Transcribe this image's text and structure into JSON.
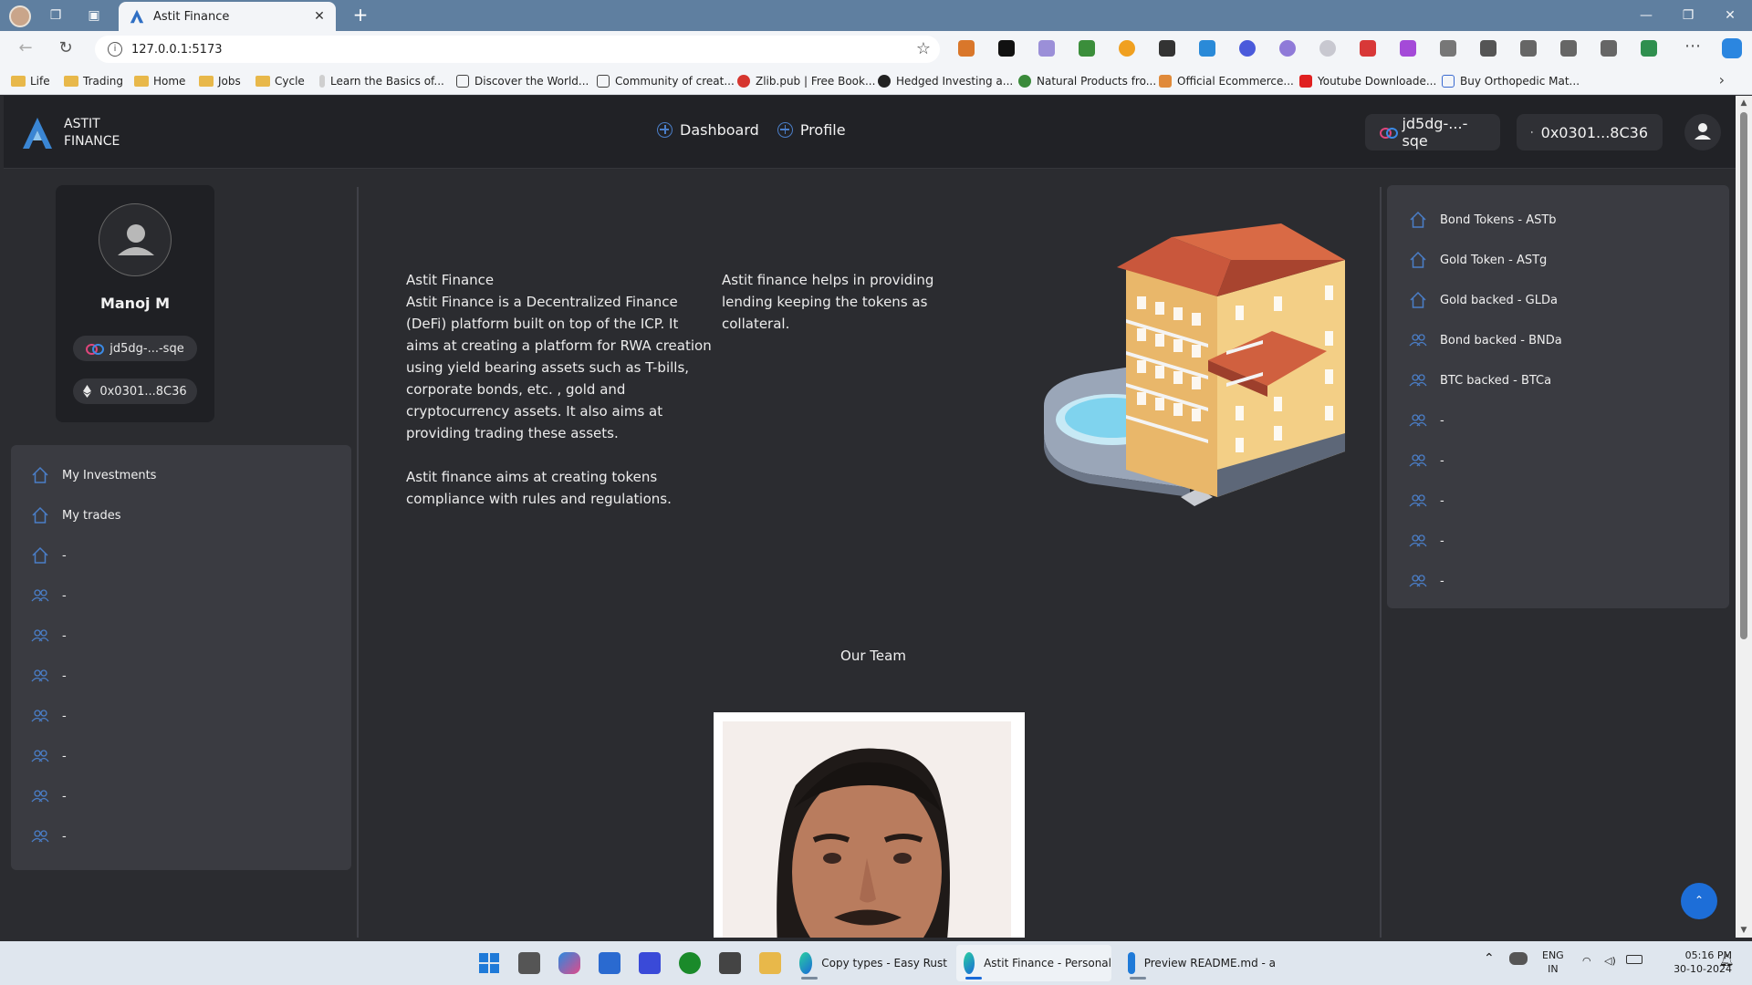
{
  "browser": {
    "tab_title": "Astit Finance",
    "address": "127.0.0.1:5173",
    "bookmarks": [
      {
        "label": "Life",
        "kind": "folder"
      },
      {
        "label": "Trading",
        "kind": "folder"
      },
      {
        "label": "Home",
        "kind": "folder"
      },
      {
        "label": "Jobs",
        "kind": "folder"
      },
      {
        "label": "Cycle",
        "kind": "folder"
      },
      {
        "label": "Learn the Basics of...",
        "kind": "link"
      },
      {
        "label": "Discover the World...",
        "kind": "link"
      },
      {
        "label": "Community of creat...",
        "kind": "link"
      },
      {
        "label": "Zlib.pub | Free Book...",
        "kind": "link"
      },
      {
        "label": "Hedged Investing a...",
        "kind": "link"
      },
      {
        "label": "Natural Products fro...",
        "kind": "link"
      },
      {
        "label": "Official Ecommerce...",
        "kind": "link"
      },
      {
        "label": "Youtube Downloade...",
        "kind": "link"
      },
      {
        "label": "Buy Orthopedic Mat...",
        "kind": "link"
      }
    ]
  },
  "header": {
    "brand_line1": "ASTIT",
    "brand_line2": "FINANCE",
    "nav": [
      {
        "label": "Dashboard"
      },
      {
        "label": "Profile"
      }
    ],
    "principal_chip": "jd5dg-...-sqe",
    "wallet_chip": "0x0301...8C36"
  },
  "profile": {
    "name": "Manoj M",
    "principal": "jd5dg-...-sqe",
    "wallet": "0x0301...8C36"
  },
  "sidebar": {
    "items": [
      {
        "label": "My Investments",
        "icon": "home-icon"
      },
      {
        "label": "My trades",
        "icon": "home-icon"
      },
      {
        "label": "-",
        "icon": "home-icon"
      },
      {
        "label": "-",
        "icon": "users-icon"
      },
      {
        "label": "-",
        "icon": "users-icon"
      },
      {
        "label": "-",
        "icon": "users-icon"
      },
      {
        "label": "-",
        "icon": "users-icon"
      },
      {
        "label": "-",
        "icon": "users-icon"
      },
      {
        "label": "-",
        "icon": "users-icon"
      },
      {
        "label": "-",
        "icon": "users-icon"
      }
    ]
  },
  "main": {
    "intro_title": "Astit Finance",
    "intro_body": "Astit Finance is a Decentralized Finance (DeFi) platform built on top of the ICP. It aims at creating a platform for RWA creation using yield bearing assets such as T-bills, corporate bonds, etc. , gold and cryptocurrency assets. It also aims at providing trading these assets.",
    "intro_tokens": "Astit finance aims at creating tokens compliance with rules and regulations.",
    "lending": "Astit finance helps in providing lending keeping the tokens as collateral.",
    "team_title": "Our Team"
  },
  "right_panel": {
    "items": [
      {
        "label": "Bond Tokens - ASTb",
        "icon": "home-icon"
      },
      {
        "label": "Gold Token - ASTg",
        "icon": "home-icon"
      },
      {
        "label": "Gold backed - GLDa",
        "icon": "home-icon"
      },
      {
        "label": "Bond backed - BNDa",
        "icon": "users-icon"
      },
      {
        "label": "BTC backed - BTCa",
        "icon": "users-icon"
      },
      {
        "label": "-",
        "icon": "users-icon"
      },
      {
        "label": "-",
        "icon": "users-icon"
      },
      {
        "label": "-",
        "icon": "users-icon"
      },
      {
        "label": "-",
        "icon": "users-icon"
      },
      {
        "label": "-",
        "icon": "users-icon"
      }
    ]
  },
  "taskbar": {
    "apps": [
      {
        "label": "Copy types - Easy Rust"
      },
      {
        "label": "Astit Finance - Personal"
      },
      {
        "label": "Preview README.md - a"
      }
    ],
    "lang_line1": "ENG",
    "lang_line2": "IN",
    "time": "05:16 PM",
    "date": "30-10-2024"
  },
  "colors": {
    "accent": "#4a7ec8",
    "page_bg": "#2b2c30",
    "panel_bg": "#3a3b41",
    "header_bg": "#212226",
    "scroll_button": "#1d6ed8"
  }
}
